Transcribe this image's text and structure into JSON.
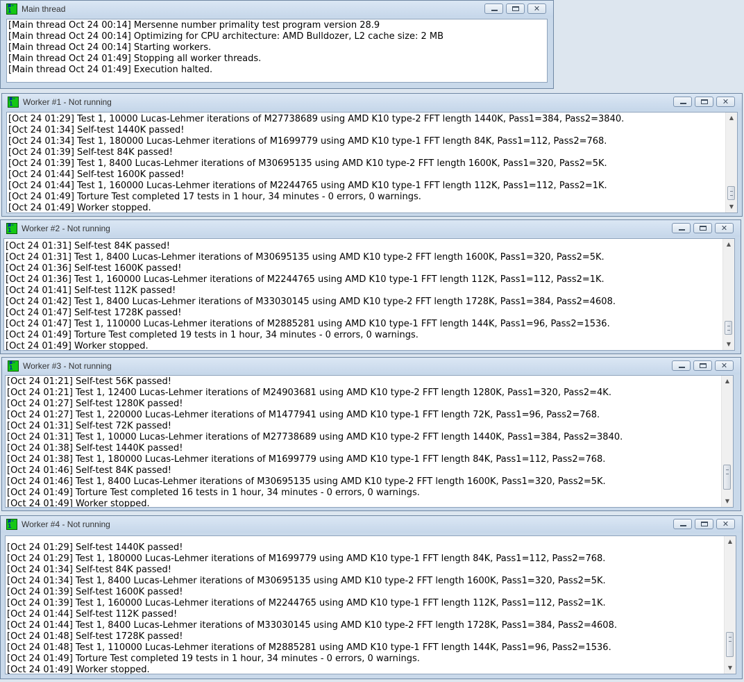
{
  "windows": {
    "main": {
      "title": "Main thread",
      "lines": [
        "[Main thread Oct 24 00:14] Mersenne number primality test program version 28.9",
        "[Main thread Oct 24 00:14] Optimizing for CPU architecture: AMD Bulldozer, L2 cache size: 2 MB",
        "[Main thread Oct 24 00:14] Starting workers.",
        "[Main thread Oct 24 01:49] Stopping all worker threads.",
        "[Main thread Oct 24 01:49] Execution halted."
      ]
    },
    "w1": {
      "title": "Worker #1 - Not running",
      "lines": [
        "[Oct 24 01:29] Test 1, 10000 Lucas-Lehmer iterations of M27738689 using AMD K10 type-2 FFT length 1440K, Pass1=384, Pass2=3840.",
        "[Oct 24 01:34] Self-test 1440K passed!",
        "[Oct 24 01:34] Test 1, 180000 Lucas-Lehmer iterations of M1699779 using AMD K10 type-1 FFT length 84K, Pass1=112, Pass2=768.",
        "[Oct 24 01:39] Self-test 84K passed!",
        "[Oct 24 01:39] Test 1, 8400 Lucas-Lehmer iterations of M30695135 using AMD K10 type-2 FFT length 1600K, Pass1=320, Pass2=5K.",
        "[Oct 24 01:44] Self-test 1600K passed!",
        "[Oct 24 01:44] Test 1, 160000 Lucas-Lehmer iterations of M2244765 using AMD K10 type-1 FFT length 112K, Pass1=112, Pass2=1K.",
        "[Oct 24 01:49] Torture Test completed 17 tests in 1 hour, 34 minutes - 0 errors, 0 warnings.",
        "[Oct 24 01:49] Worker stopped."
      ]
    },
    "w2": {
      "title": "Worker #2 - Not running",
      "lines": [
        "[Oct 24 01:31] Self-test 84K passed!",
        "[Oct 24 01:31] Test 1, 8400 Lucas-Lehmer iterations of M30695135 using AMD K10 type-2 FFT length 1600K, Pass1=320, Pass2=5K.",
        "[Oct 24 01:36] Self-test 1600K passed!",
        "[Oct 24 01:36] Test 1, 160000 Lucas-Lehmer iterations of M2244765 using AMD K10 type-1 FFT length 112K, Pass1=112, Pass2=1K.",
        "[Oct 24 01:41] Self-test 112K passed!",
        "[Oct 24 01:42] Test 1, 8400 Lucas-Lehmer iterations of M33030145 using AMD K10 type-2 FFT length 1728K, Pass1=384, Pass2=4608.",
        "[Oct 24 01:47] Self-test 1728K passed!",
        "[Oct 24 01:47] Test 1, 110000 Lucas-Lehmer iterations of M2885281 using AMD K10 type-1 FFT length 144K, Pass1=96, Pass2=1536.",
        "[Oct 24 01:49] Torture Test completed 19 tests in 1 hour, 34 minutes - 0 errors, 0 warnings.",
        "[Oct 24 01:49] Worker stopped."
      ]
    },
    "w3": {
      "title": "Worker #3 - Not running",
      "lines": [
        "[Oct 24 01:21] Self-test 56K passed!",
        "[Oct 24 01:21] Test 1, 12400 Lucas-Lehmer iterations of M24903681 using AMD K10 type-2 FFT length 1280K, Pass1=320, Pass2=4K.",
        "[Oct 24 01:27] Self-test 1280K passed!",
        "[Oct 24 01:27] Test 1, 220000 Lucas-Lehmer iterations of M1477941 using AMD K10 type-1 FFT length 72K, Pass1=96, Pass2=768.",
        "[Oct 24 01:31] Self-test 72K passed!",
        "[Oct 24 01:31] Test 1, 10000 Lucas-Lehmer iterations of M27738689 using AMD K10 type-2 FFT length 1440K, Pass1=384, Pass2=3840.",
        "[Oct 24 01:38] Self-test 1440K passed!",
        "[Oct 24 01:38] Test 1, 180000 Lucas-Lehmer iterations of M1699779 using AMD K10 type-1 FFT length 84K, Pass1=112, Pass2=768.",
        "[Oct 24 01:46] Self-test 84K passed!",
        "[Oct 24 01:46] Test 1, 8400 Lucas-Lehmer iterations of M30695135 using AMD K10 type-2 FFT length 1600K, Pass1=320, Pass2=5K.",
        "[Oct 24 01:49] Torture Test completed 16 tests in 1 hour, 34 minutes - 0 errors, 0 warnings.",
        "[Oct 24 01:49] Worker stopped."
      ]
    },
    "w4": {
      "title": "Worker #4 - Not running",
      "lines": [
        "[Oct 24 01:29] Self-test 1440K passed!",
        "[Oct 24 01:29] Test 1, 180000 Lucas-Lehmer iterations of M1699779 using AMD K10 type-1 FFT length 84K, Pass1=112, Pass2=768.",
        "[Oct 24 01:34] Self-test 84K passed!",
        "[Oct 24 01:34] Test 1, 8400 Lucas-Lehmer iterations of M30695135 using AMD K10 type-2 FFT length 1600K, Pass1=320, Pass2=5K.",
        "[Oct 24 01:39] Self-test 1600K passed!",
        "[Oct 24 01:39] Test 1, 160000 Lucas-Lehmer iterations of M2244765 using AMD K10 type-1 FFT length 112K, Pass1=112, Pass2=1K.",
        "[Oct 24 01:44] Self-test 112K passed!",
        "[Oct 24 01:44] Test 1, 8400 Lucas-Lehmer iterations of M33030145 using AMD K10 type-2 FFT length 1728K, Pass1=384, Pass2=4608.",
        "[Oct 24 01:48] Self-test 1728K passed!",
        "[Oct 24 01:48] Test 1, 110000 Lucas-Lehmer iterations of M2885281 using AMD K10 type-1 FFT length 144K, Pass1=96, Pass2=1536.",
        "[Oct 24 01:49] Torture Test completed 19 tests in 1 hour, 34 minutes - 0 errors, 0 warnings.",
        "[Oct 24 01:49] Worker stopped."
      ]
    }
  }
}
